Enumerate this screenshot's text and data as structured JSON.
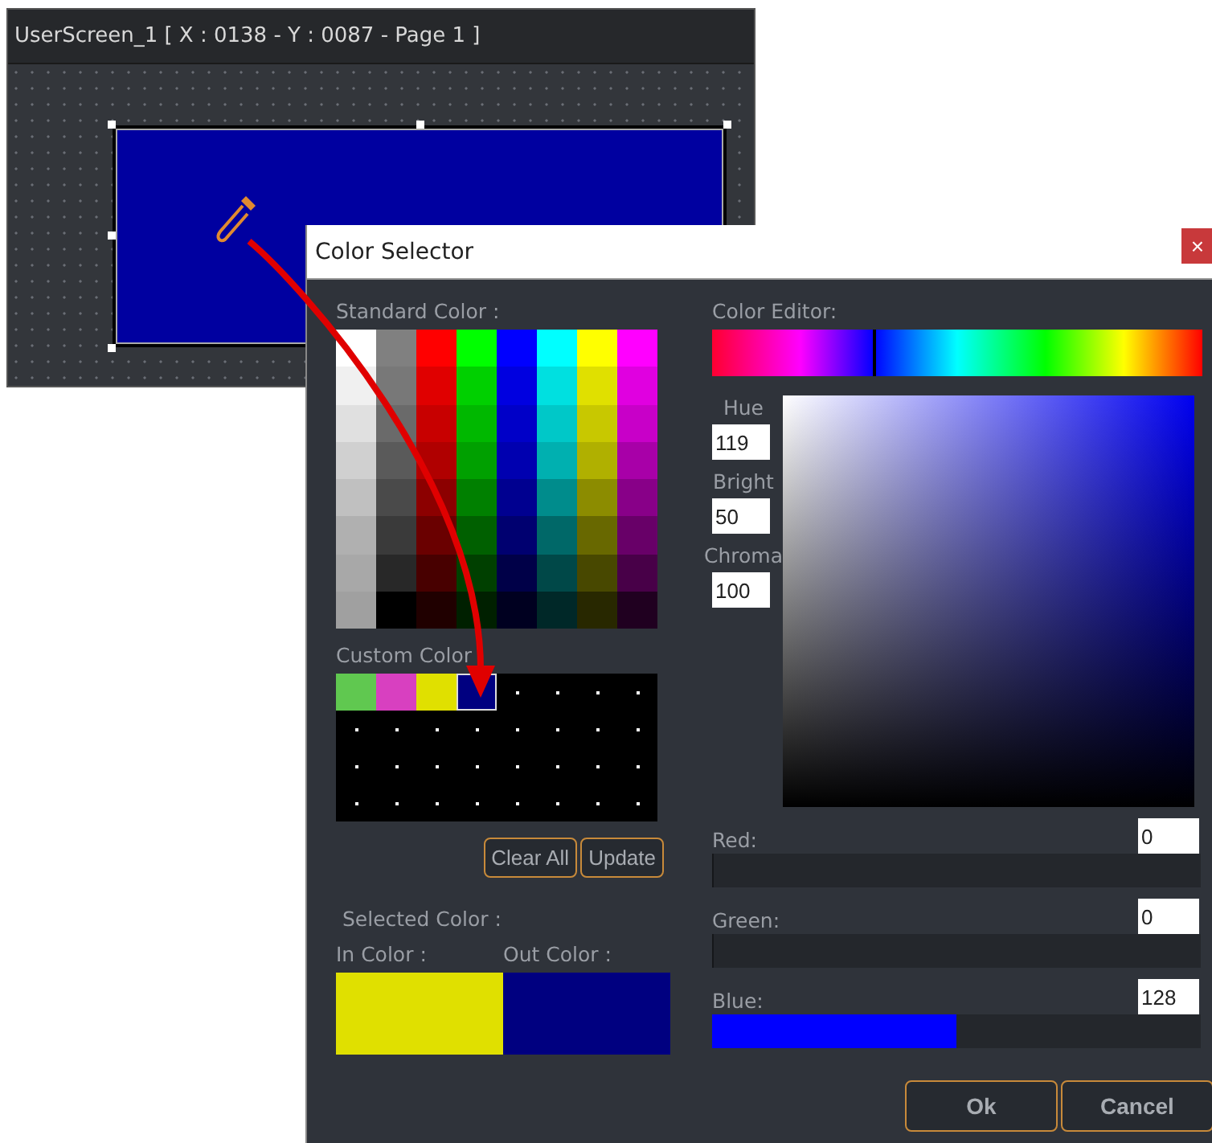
{
  "editor": {
    "title": "UserScreen_1 [ X : 0138 - Y : 0087 - Page 1 ]"
  },
  "dialog": {
    "title": "Color Selector",
    "close": "×"
  },
  "standard_color": {
    "label": "Standard Color :",
    "rows": [
      {
        "cells": [
          {
            "color": "#ffffff"
          },
          {
            "color": "#808080"
          },
          {
            "color": "#ff0000"
          },
          {
            "color": "#00ff00"
          },
          {
            "color": "#0000ff"
          },
          {
            "color": "#00ffff"
          },
          {
            "color": "#ffff00"
          },
          {
            "color": "#ff00ff"
          }
        ]
      },
      {
        "cells": [
          {
            "color": "#f0f0f0"
          },
          {
            "color": "#787878"
          },
          {
            "color": "#e00000"
          },
          {
            "color": "#00d000"
          },
          {
            "color": "#0000e0"
          },
          {
            "color": "#00e0e0"
          },
          {
            "color": "#e0e000"
          },
          {
            "color": "#e000e0"
          }
        ]
      },
      {
        "cells": [
          {
            "color": "#e0e0e0"
          },
          {
            "color": "#6a6a6a"
          },
          {
            "color": "#c80000"
          },
          {
            "color": "#00b800"
          },
          {
            "color": "#0000c8"
          },
          {
            "color": "#00c8c8"
          },
          {
            "color": "#c8c800"
          },
          {
            "color": "#c800c8"
          }
        ]
      },
      {
        "cells": [
          {
            "color": "#d0d0d0"
          },
          {
            "color": "#5a5a5a"
          },
          {
            "color": "#b00000"
          },
          {
            "color": "#00a000"
          },
          {
            "color": "#0000b0"
          },
          {
            "color": "#00b0b0"
          },
          {
            "color": "#b0b000"
          },
          {
            "color": "#a800a8"
          }
        ]
      },
      {
        "cells": [
          {
            "color": "#c0c0c0"
          },
          {
            "color": "#4a4a4a"
          },
          {
            "color": "#8c0000"
          },
          {
            "color": "#008000"
          },
          {
            "color": "#000090"
          },
          {
            "color": "#008c8c"
          },
          {
            "color": "#8c8c00"
          },
          {
            "color": "#880088"
          }
        ]
      },
      {
        "cells": [
          {
            "color": "#b0b0b0"
          },
          {
            "color": "#3a3a3a"
          },
          {
            "color": "#6a0000"
          },
          {
            "color": "#006000"
          },
          {
            "color": "#000070"
          },
          {
            "color": "#006868"
          },
          {
            "color": "#686800"
          },
          {
            "color": "#680068"
          }
        ]
      },
      {
        "cells": [
          {
            "color": "#a8a8a8"
          },
          {
            "color": "#282828"
          },
          {
            "color": "#480000"
          },
          {
            "color": "#004000"
          },
          {
            "color": "#000048"
          },
          {
            "color": "#004848"
          },
          {
            "color": "#484800"
          },
          {
            "color": "#480048"
          }
        ]
      },
      {
        "cells": [
          {
            "color": "#a0a0a0"
          },
          {
            "color": "#000000"
          },
          {
            "color": "#200000"
          },
          {
            "color": "#002000"
          },
          {
            "color": "#000020"
          },
          {
            "color": "#002828"
          },
          {
            "color": "#282800"
          },
          {
            "color": "#200020"
          }
        ]
      }
    ]
  },
  "custom_color": {
    "label": "Custom Color",
    "slots": [
      {
        "kind": "color",
        "color": "#60c850",
        "selected": false
      },
      {
        "kind": "color",
        "color": "#d840c0",
        "selected": false
      },
      {
        "kind": "color",
        "color": "#e0e000",
        "selected": false
      },
      {
        "kind": "color",
        "color": "#000080",
        "selected": true
      },
      {
        "kind": "empty",
        "selected": false
      },
      {
        "kind": "empty",
        "selected": false
      },
      {
        "kind": "empty",
        "selected": false
      },
      {
        "kind": "empty",
        "selected": false
      },
      {
        "kind": "empty",
        "selected": false
      },
      {
        "kind": "empty",
        "selected": false
      },
      {
        "kind": "empty",
        "selected": false
      },
      {
        "kind": "empty",
        "selected": false
      },
      {
        "kind": "empty",
        "selected": false
      },
      {
        "kind": "empty",
        "selected": false
      },
      {
        "kind": "empty",
        "selected": false
      },
      {
        "kind": "empty",
        "selected": false
      },
      {
        "kind": "empty",
        "selected": false
      },
      {
        "kind": "empty",
        "selected": false
      },
      {
        "kind": "empty",
        "selected": false
      },
      {
        "kind": "empty",
        "selected": false
      },
      {
        "kind": "empty",
        "selected": false
      },
      {
        "kind": "empty",
        "selected": false
      },
      {
        "kind": "empty",
        "selected": false
      },
      {
        "kind": "empty",
        "selected": false
      },
      {
        "kind": "empty",
        "selected": false
      },
      {
        "kind": "empty",
        "selected": false
      },
      {
        "kind": "empty",
        "selected": false
      },
      {
        "kind": "empty",
        "selected": false
      },
      {
        "kind": "empty",
        "selected": false
      },
      {
        "kind": "empty",
        "selected": false
      },
      {
        "kind": "empty",
        "selected": false
      },
      {
        "kind": "empty",
        "selected": false
      }
    ],
    "buttons": [
      "Clear All",
      "Update"
    ]
  },
  "selected_color": {
    "label": "Selected Color :",
    "in": {
      "label": "In Color :",
      "color": "#e0e000"
    },
    "out": {
      "label": "Out Color :",
      "color": "#000080"
    }
  },
  "color_editor": {
    "label": "Color Editor:",
    "hue_level": {
      "level": 0.33
    },
    "fields": [
      {
        "label": "Hue",
        "value": "119"
      },
      {
        "label": "Bright",
        "value": "50"
      },
      {
        "label": "Chroma",
        "value": "100"
      }
    ],
    "channels": [
      {
        "label": "Red:",
        "value": "0",
        "level": 0
      },
      {
        "label": "Green:",
        "value": "0",
        "level": 0
      },
      {
        "label": "Blue:",
        "value": "128",
        "level": 0.5,
        "color": "#0000ff"
      }
    ]
  },
  "buttons": [
    "Ok",
    "Cancel"
  ]
}
